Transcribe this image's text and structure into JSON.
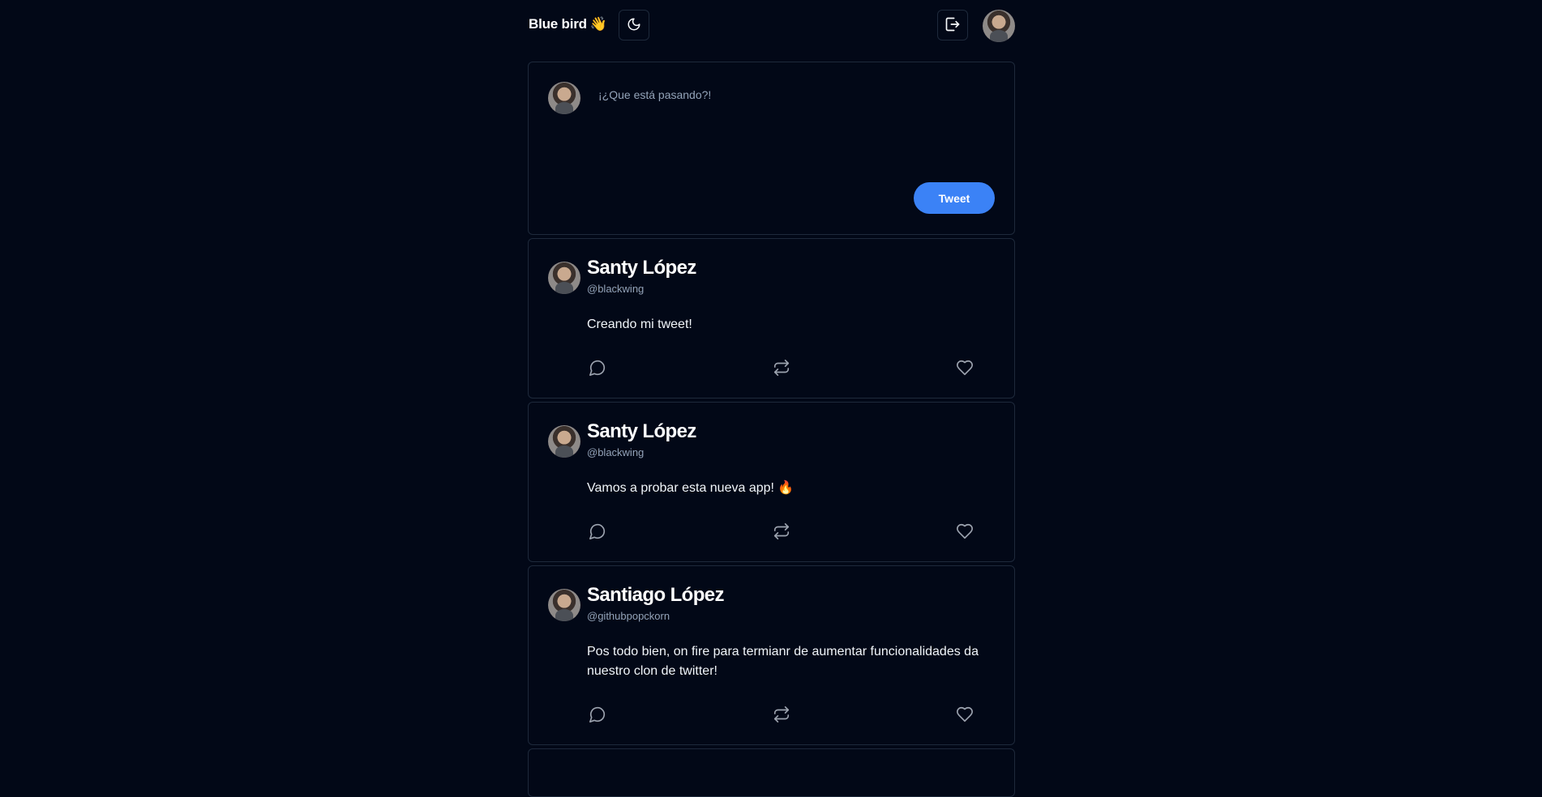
{
  "header": {
    "brand": "Blue bird",
    "brand_emoji": "👋",
    "theme_icon": "moon-icon",
    "logout_icon": "logout-icon"
  },
  "composer": {
    "placeholder": "¡¿Que está pasando?!",
    "submit_label": "Tweet"
  },
  "posts": [
    {
      "name": "Santy López",
      "handle": "@blackwing",
      "body": "Creando mi tweet!"
    },
    {
      "name": "Santy López",
      "handle": "@blackwing",
      "body": "Vamos a probar esta nueva app! 🔥"
    },
    {
      "name": "Santiago López",
      "handle": "@githubpopckorn",
      "body": "Pos todo bien, on fire para termianr de aumentar funcionalidades da nuestro clon de twitter!"
    }
  ],
  "colors": {
    "background": "#020817",
    "border": "#1e293b",
    "accent": "#3b82f6",
    "muted": "#94a3b8"
  }
}
